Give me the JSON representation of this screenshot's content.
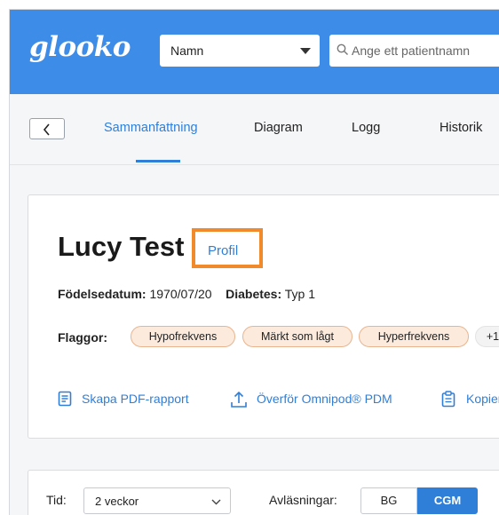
{
  "header": {
    "logo": "glooko",
    "name_select": "Namn",
    "search_placeholder": "Ange ett patientnamn"
  },
  "nav": {
    "tabs": [
      {
        "label": "Sammanfattning",
        "active": true
      },
      {
        "label": "Diagram"
      },
      {
        "label": "Logg"
      },
      {
        "label": "Historik"
      }
    ]
  },
  "patient": {
    "name": "Lucy Test",
    "profile_link": "Profil",
    "birth_label": "Födelsedatum:",
    "birth_value": "1970/07/20",
    "diabetes_label": "Diabetes:",
    "diabetes_value": "Typ 1",
    "flags_label": "Flaggor:",
    "flags": [
      "Hypofrekvens",
      "Märkt som lågt",
      "Hyperfrekvens"
    ],
    "flags_more": "+1",
    "actions": [
      {
        "label": "Skapa PDF-rapport",
        "icon": "pdf-report-icon"
      },
      {
        "label": "Överför Omnipod® PDM",
        "icon": "upload-icon"
      },
      {
        "label": "Kopiera",
        "icon": "clipboard-icon"
      }
    ]
  },
  "filters": {
    "time_label": "Tid:",
    "time_value": "2 veckor",
    "readings_label": "Avläsningar:",
    "readings_options": [
      "BG",
      "CGM"
    ],
    "readings_selected": "CGM"
  },
  "colors": {
    "header_blue": "#3d8de8",
    "accent_blue": "#2f7fd9",
    "highlight_orange": "#f08a2b",
    "flag_bg": "#fcebdd"
  }
}
